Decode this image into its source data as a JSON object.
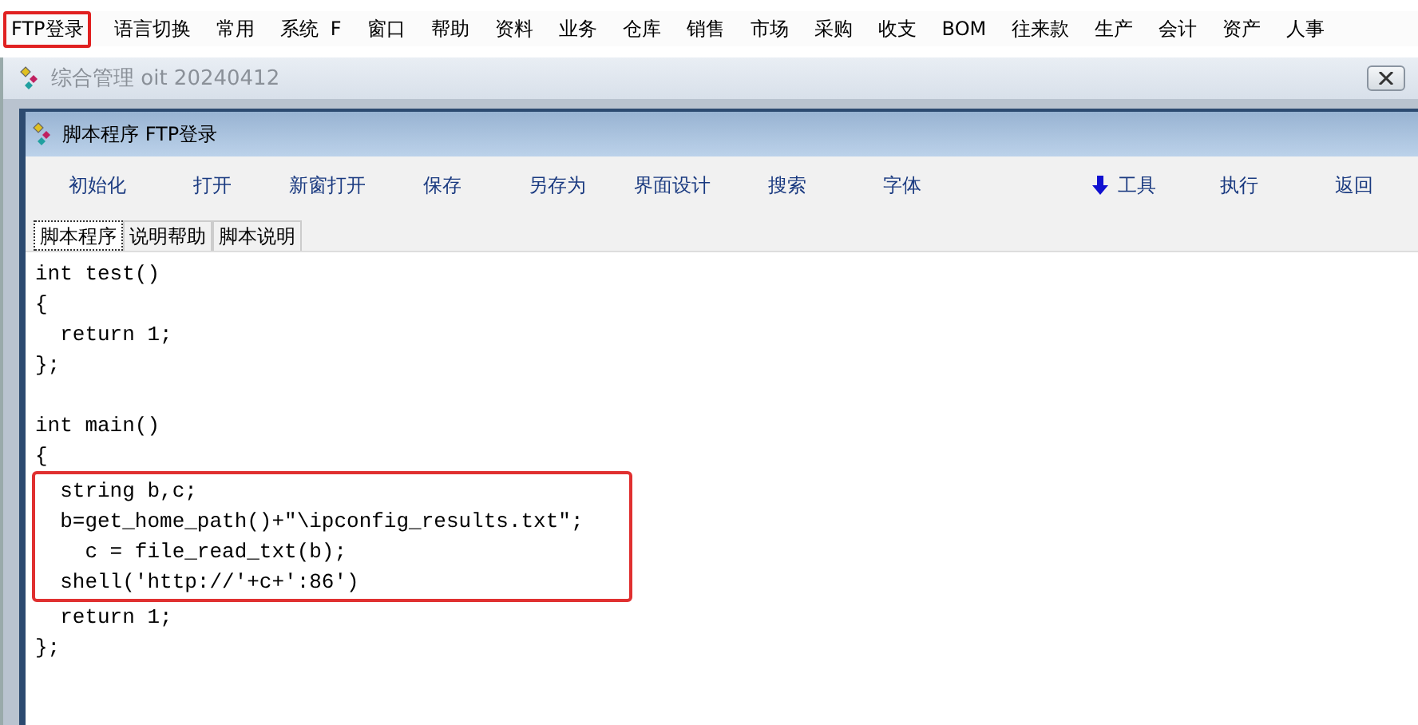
{
  "menu_bar": [
    {
      "label": "FTP登录",
      "highlighted": true
    },
    {
      "label": "语言切换",
      "highlighted": false
    },
    {
      "label": "常用",
      "highlighted": false
    },
    {
      "label": "系统  F",
      "highlighted": false
    },
    {
      "label": "窗口",
      "highlighted": false
    },
    {
      "label": "帮助",
      "highlighted": false
    },
    {
      "label": "资料",
      "highlighted": false
    },
    {
      "label": "业务",
      "highlighted": false
    },
    {
      "label": "仓库",
      "highlighted": false
    },
    {
      "label": "销售",
      "highlighted": false
    },
    {
      "label": "市场",
      "highlighted": false
    },
    {
      "label": "采购",
      "highlighted": false
    },
    {
      "label": "收支",
      "highlighted": false
    },
    {
      "label": "BOM",
      "highlighted": false
    },
    {
      "label": "往来款",
      "highlighted": false
    },
    {
      "label": "生产",
      "highlighted": false
    },
    {
      "label": "会计",
      "highlighted": false
    },
    {
      "label": "资产",
      "highlighted": false
    },
    {
      "label": "人事",
      "highlighted": false
    }
  ],
  "outer_window": {
    "title": "综合管理 oit 20240412"
  },
  "inner_window": {
    "title": "脚本程序  FTP登录"
  },
  "toolbar": {
    "left": [
      {
        "label": "初始化"
      },
      {
        "label": "打开"
      },
      {
        "label": "新窗打开"
      },
      {
        "label": "保存"
      },
      {
        "label": "另存为"
      },
      {
        "label": "界面设计"
      },
      {
        "label": "搜索"
      },
      {
        "label": "字体"
      }
    ],
    "right": [
      {
        "label": "工具",
        "kind": "dropdown"
      },
      {
        "label": "执行",
        "kind": "plain"
      },
      {
        "label": "返回",
        "kind": "plain"
      }
    ]
  },
  "tabs": [
    {
      "label": "脚本程序",
      "selected": true
    },
    {
      "label": "说明帮助",
      "selected": false
    },
    {
      "label": "脚本说明",
      "selected": false
    }
  ],
  "code": {
    "lines": [
      {
        "text": "int test()",
        "highlighted": false
      },
      {
        "text": "{",
        "highlighted": false
      },
      {
        "text": "  return 1;",
        "highlighted": false
      },
      {
        "text": "};",
        "highlighted": false
      },
      {
        "kind": "blank"
      },
      {
        "text": "int main()",
        "highlighted": false
      },
      {
        "text": "{",
        "highlighted": false
      },
      {
        "text": "  string b,c;",
        "highlighted": true
      },
      {
        "text": "  b=get_home_path()+\"\\ipconfig_results.txt\";",
        "highlighted": true
      },
      {
        "text": "    c = file_read_txt(b);",
        "highlighted": true
      },
      {
        "text": "  shell('http://'+c+':86')",
        "highlighted": true
      },
      {
        "text": "  return 1;",
        "highlighted": false
      },
      {
        "text": "};",
        "highlighted": false
      }
    ]
  }
}
